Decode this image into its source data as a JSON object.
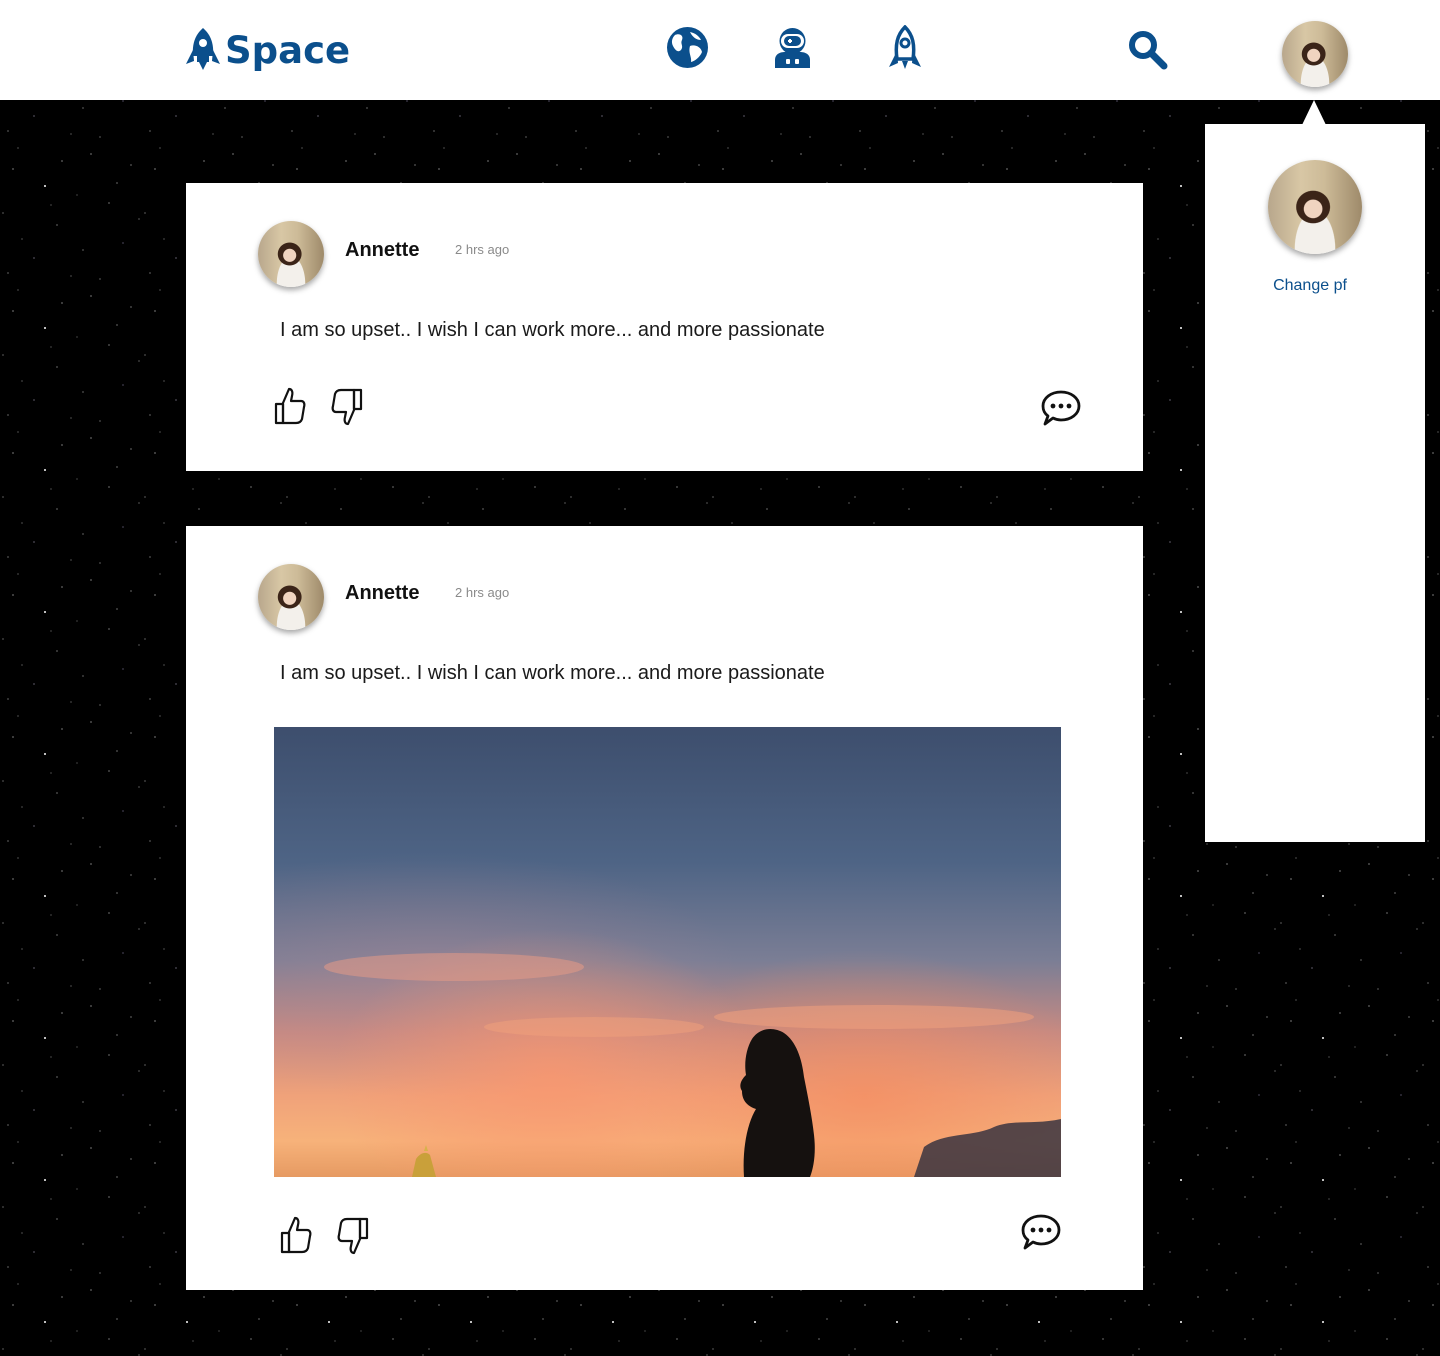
{
  "header": {
    "brand_name": "Space",
    "nav_icons": [
      "rocket-logo-icon",
      "globe-icon",
      "astronaut-icon",
      "rocket-icon",
      "search-icon"
    ],
    "brand_color": "#0b4f8c"
  },
  "profile_panel": {
    "change_label": "Change pf"
  },
  "posts": [
    {
      "author": "Annette",
      "time": "2 hrs ago",
      "text": "I am so upset.. I wish I can work more... and more passionate",
      "has_image": false
    },
    {
      "author": "Annette",
      "time": "2 hrs ago",
      "text": "I am so upset.. I wish I can work more... and more passionate",
      "has_image": true
    }
  ],
  "actions": [
    "thumbs-up-icon",
    "thumbs-down-icon",
    "comment-icon"
  ]
}
